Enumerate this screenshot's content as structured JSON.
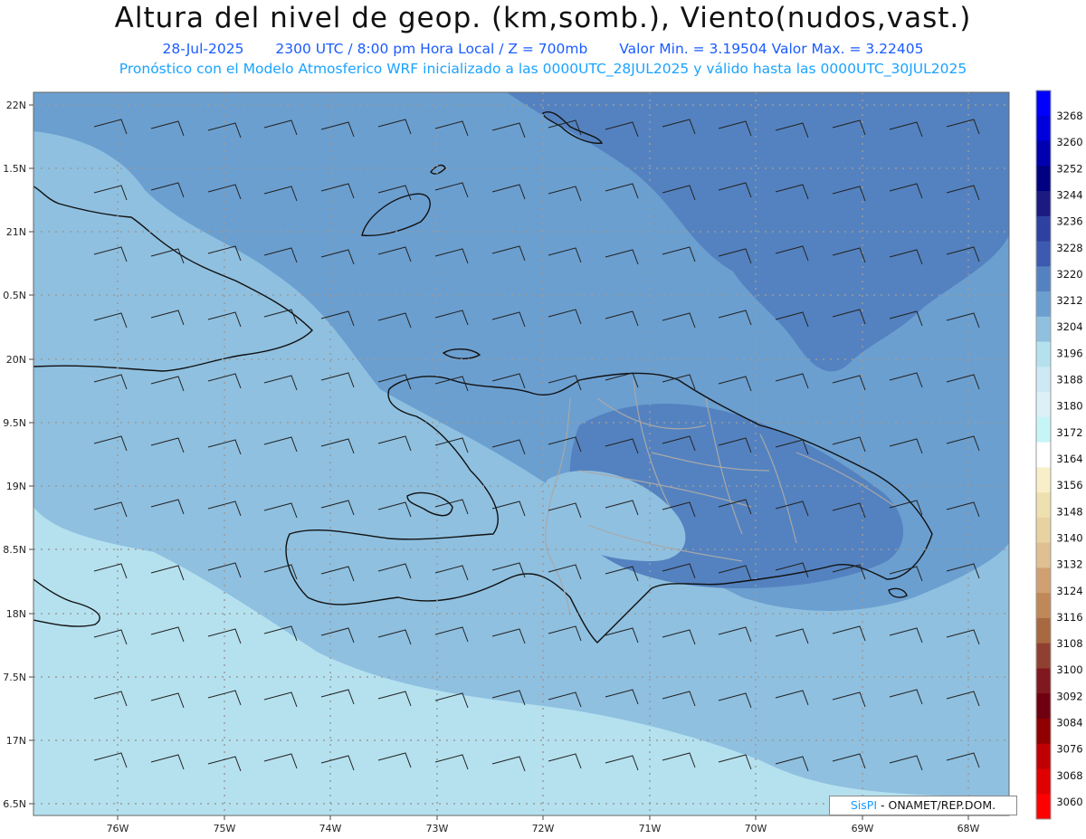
{
  "header": {
    "title": "Altura del nivel de geop. (km,somb.), Viento(nudos,vast.)",
    "date": "28-Jul-2025",
    "time_level": "2300 UTC / 8:00 pm Hora Local / Z = 700mb",
    "min_max": "Valor Min. = 3.19504  Valor Max. = 3.22405",
    "forecast_note": "Pronóstico con el Modelo Atmosferico WRF inicializado a las 0000UTC_28JUL2025 y válido hasta las  0000UTC_30JUL2025"
  },
  "map": {
    "lon_labels": [
      "76W",
      "75W",
      "74W",
      "73W",
      "72W",
      "71W",
      "70W",
      "69W",
      "68W"
    ],
    "lat_labels": [
      "22N",
      "1.5N",
      "21N",
      "0.5N",
      "20N",
      "9.5N",
      "19N",
      "8.5N",
      "18N",
      "7.5N",
      "17N",
      "6.5N"
    ],
    "colors": {
      "shade_3196": "#b5e1ef",
      "shade_3204": "#8fc0e0",
      "shade_3212": "#6b9fd0",
      "shade_3220": "#5482c0",
      "coast": "#111111",
      "provinces": "#a8a8a8",
      "grid": "#9a9a9a",
      "wind_barb": "#222222"
    }
  },
  "colorbar": {
    "labels": [
      "3268",
      "3260",
      "3252",
      "3244",
      "3236",
      "3228",
      "3220",
      "3212",
      "3204",
      "3196",
      "3188",
      "3180",
      "3172",
      "3164",
      "3156",
      "3148",
      "3140",
      "3132",
      "3124",
      "3116",
      "3108",
      "3100",
      "3092",
      "3084",
      "3076",
      "3068",
      "3060"
    ],
    "colors": [
      "#0000ff",
      "#0000dd",
      "#0000b0",
      "#000080",
      "#1a1a80",
      "#2e40a0",
      "#3c5ab0",
      "#5482c0",
      "#6b9fd0",
      "#8fc0e0",
      "#b5e1ef",
      "#cdeaf4",
      "#dcf1f7",
      "#c6f5f7",
      "#ffffff",
      "#f8efc8",
      "#efe0b0",
      "#e8d2a0",
      "#e0c090",
      "#d0a070",
      "#c08858",
      "#a86840",
      "#904030",
      "#801820",
      "#700010",
      "#900000",
      "#c00000",
      "#e00000",
      "#ff0000"
    ]
  },
  "credit": {
    "brand": "SisPI",
    "text": "- ONAMET/REP.DOM."
  }
}
